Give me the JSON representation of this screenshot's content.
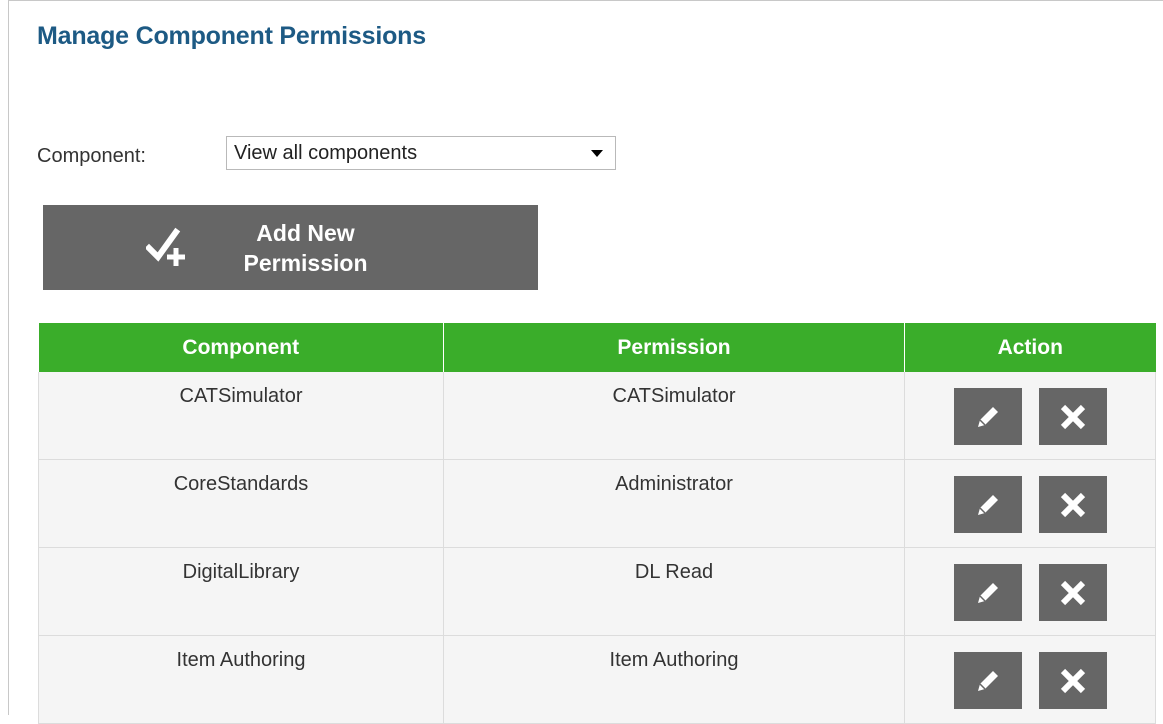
{
  "page": {
    "title": "Manage Component Permissions"
  },
  "filter": {
    "label": "Component:",
    "selected": "View all components"
  },
  "add_button": {
    "label": "Add New Permission",
    "icon": "check-plus-icon"
  },
  "table": {
    "headers": [
      "Component",
      "Permission",
      "Action"
    ],
    "rows": [
      {
        "component": "CATSimulator",
        "permission": "CATSimulator"
      },
      {
        "component": "CoreStandards",
        "permission": "Administrator"
      },
      {
        "component": "DigitalLibrary",
        "permission": "DL Read"
      },
      {
        "component": "Item Authoring",
        "permission": "Item Authoring"
      }
    ],
    "row_actions": [
      "edit-icon",
      "delete-icon"
    ]
  },
  "colors": {
    "title": "#1d5a84",
    "header_bg": "#3aad2a",
    "button_bg": "#666666",
    "row_bg": "#f5f5f5"
  }
}
